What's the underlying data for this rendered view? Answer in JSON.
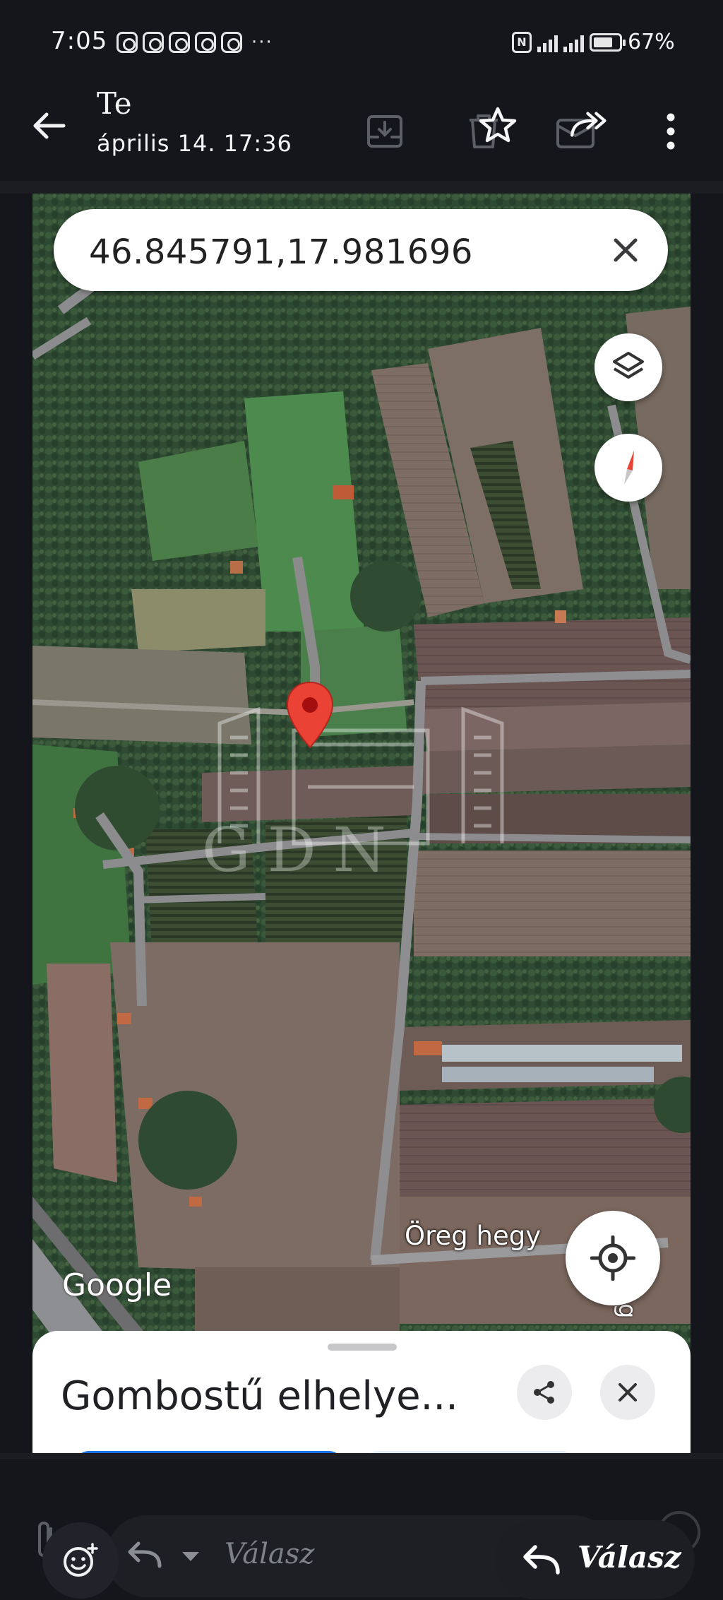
{
  "status_bar": {
    "time": "7:05",
    "notification_icons": [
      "notification-icon",
      "notification-icon",
      "notification-icon",
      "notification-icon",
      "notification-icon"
    ],
    "more_indicator": "···",
    "nfc_label": "N",
    "battery_percent": "67%",
    "battery_level": 0.67
  },
  "header": {
    "sender": "Te",
    "date": "április 14.",
    "time": "17:36",
    "actions": [
      "back-arrow-icon",
      "archive-icon",
      "delete-icon",
      "star-icon",
      "move-icon",
      "forward-icon",
      "more-vert-icon"
    ]
  },
  "map_screenshot": {
    "search_value": "46.845791,17.981696",
    "road_label": "Öreg hegy",
    "road_label_side": "Öreg h",
    "logo": "Google",
    "sheet_title": "Gombostű elhelye...",
    "watermark_text": "GDN",
    "pin_color": "#ea4335"
  },
  "reply_bar": {
    "placeholder": "Válasz",
    "reply_button_label": "Válasz"
  },
  "colors": {
    "background": "#15161b",
    "map_green": "#3b5d3a",
    "pin_red": "#ea4335"
  }
}
